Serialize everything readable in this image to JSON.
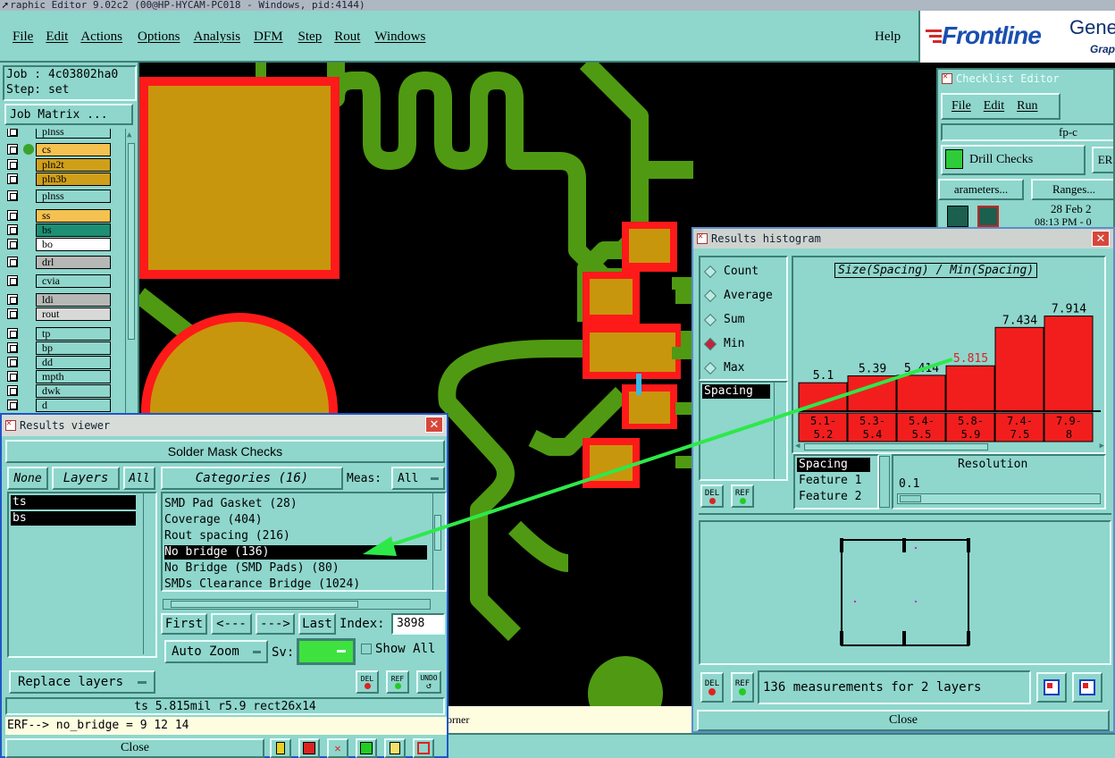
{
  "window_title": "raphic Editor 9.02c2 (00@HP-HYCAM-PC018 - Windows, pid:4144)",
  "menu": [
    "File",
    "Edit",
    "Actions",
    "Options",
    "Analysis",
    "DFM",
    "Step",
    "Rout",
    "Windows"
  ],
  "help_label": "Help",
  "brand": {
    "name": "Frontline",
    "gen": "Gene",
    "graph": "Grap"
  },
  "job": {
    "job_line": "Job : 4c03802ha0",
    "step_line": "Step: set",
    "matrix_button": "Job Matrix ..."
  },
  "layers": [
    {
      "name": "plnss",
      "color": "#8fd6cc"
    },
    {
      "name": "cs",
      "color": "#f5c150"
    },
    {
      "name": "pln2t",
      "color": "#d09f1a"
    },
    {
      "name": "pln3b",
      "color": "#d09f1a"
    },
    {
      "name": "plnss",
      "color": "#8fd6cc"
    },
    {
      "name": "ss",
      "color": "#f5c150"
    },
    {
      "name": "bs",
      "color": "#1c8f74"
    },
    {
      "name": "bo",
      "color": "#ffffff"
    },
    {
      "name": "drl",
      "color": "#b6b8b6"
    },
    {
      "name": "cvia",
      "color": "#8fd6cc"
    },
    {
      "name": "ldi",
      "color": "#b6b8b6"
    },
    {
      "name": "rout",
      "color": "#d8d8d8"
    },
    {
      "name": "tp",
      "color": "#8fd6cc"
    },
    {
      "name": "bp",
      "color": "#8fd6cc"
    },
    {
      "name": "dd",
      "color": "#8fd6cc"
    },
    {
      "name": "mpth",
      "color": "#8fd6cc"
    },
    {
      "name": "dwk",
      "color": "#8fd6cc"
    },
    {
      "name": "d",
      "color": "#8fd6cc"
    }
  ],
  "results_viewer": {
    "title": "Results viewer",
    "heading": "Solder Mask Checks",
    "tabs": {
      "none": "None",
      "layers": "Layers",
      "all": "All"
    },
    "layer_list": [
      "ts",
      "bs"
    ],
    "categories_label": "Categories (16)",
    "meas_label": "Meas:",
    "meas_value": "All",
    "categories": [
      "SMD Pad Gasket (28)",
      "Coverage (404)",
      "Rout spacing (216)",
      "No bridge (136)",
      "No Bridge (SMD Pads) (80)",
      "SMDs Clearance Bridge (1024)"
    ],
    "nav": {
      "first": "First",
      "prev": "<---",
      "next": "--->",
      "last": "Last",
      "index_label": "Index:",
      "index_value": "3898"
    },
    "auto_zoom": "Auto Zoom",
    "sv_label": "Sv:",
    "show_all": "Show All",
    "replace_layers": "Replace layers",
    "btn_del": "DEL",
    "btn_ref": "REF",
    "btn_undo": "UNDO",
    "status": "ts 5.815mil   r5.9   rect26x14",
    "erf_line": "ERF--> no_bridge = 9 12 14",
    "close": "Close"
  },
  "histogram": {
    "title": "Results histogram",
    "modes": [
      "Count",
      "Average",
      "Sum",
      "Min",
      "Max"
    ],
    "selected_mode": "Min",
    "list_item": "Spacing",
    "chart_title": "Size(Spacing) / Min(Spacing)",
    "legend_rows": [
      "Spacing",
      "Feature 1",
      "Feature 2"
    ],
    "resolution_label": "Resolution",
    "resolution_value": "0.1",
    "summary": "136 measurements for 2 layers",
    "btn_del": "DEL",
    "btn_ref": "REF",
    "close": "Close",
    "edge_text": "orner"
  },
  "chart_data": {
    "type": "bar",
    "title": "Size(Spacing) / Min(Spacing)",
    "categories": [
      "5.1-\n5.2",
      "5.3-\n5.4",
      "5.4-\n5.5",
      "5.8-\n5.9",
      "7.4-\n7.5",
      "7.9-\n8"
    ],
    "values": [
      5.1,
      5.39,
      5.414,
      5.815,
      7.434,
      7.914
    ],
    "value_labels": [
      "5.1",
      "5.39",
      "5.414",
      "5.815",
      "7.434",
      "7.914"
    ],
    "highlight_index": 3,
    "bar_color": "#f21e1e",
    "highlight_label_color": "#e02020",
    "ylim": [
      3.9,
      8.2
    ]
  },
  "checklist": {
    "title": "Checklist Editor",
    "menu": [
      "File",
      "Edit",
      "Run"
    ],
    "fp_label": "fp-c",
    "drill_checks": "Drill Checks",
    "erf_button": "ER",
    "parameters": "arameters...",
    "ranges": "Ranges...",
    "date_line1": "28 Feb 2",
    "date_line2": "08:13 PM - 0"
  },
  "colors": {
    "teal": "#8fd6cc",
    "copper": "#c8960c",
    "mask": "#ff1a1a",
    "trace": "#4f9a12",
    "arrow": "#2ee84a"
  }
}
